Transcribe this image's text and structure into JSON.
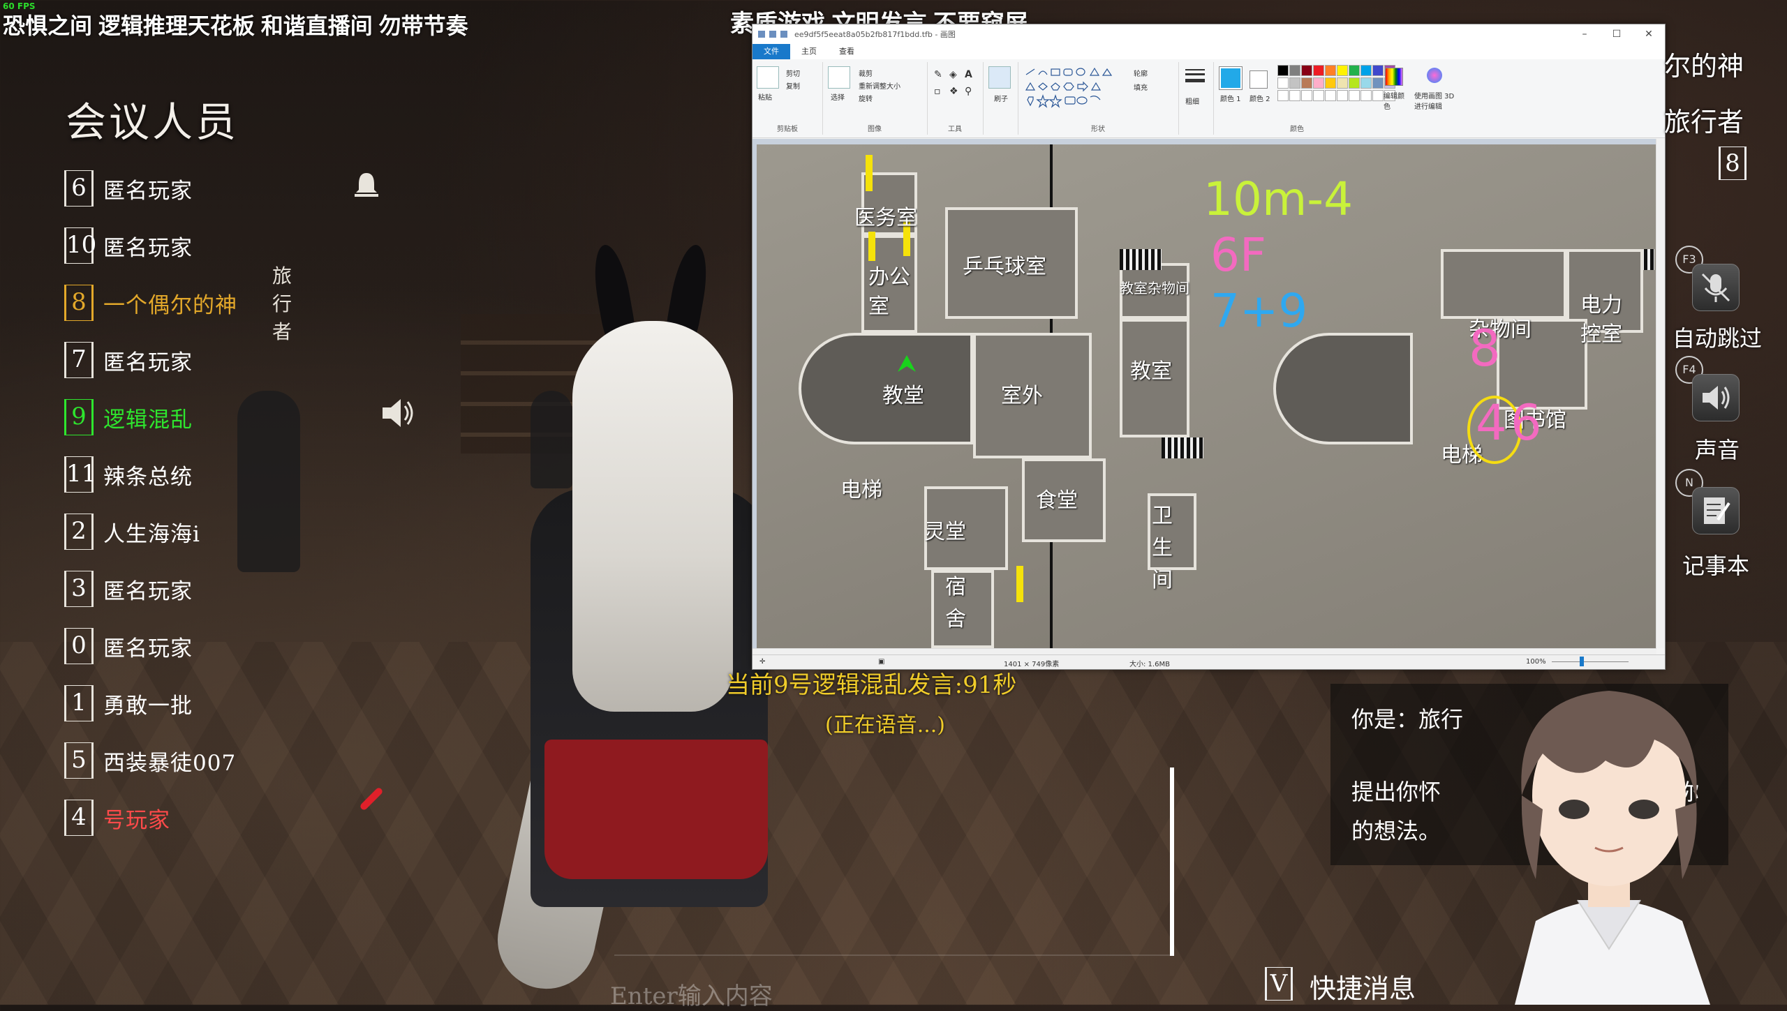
{
  "overlay": {
    "fps": "60 FPS",
    "banner_left": "恐惧之间 逻辑推理天花板 和谐直播间 勿带节奏",
    "banner_center": "素质游戏 文明发言 不要窥屏"
  },
  "players_panel": {
    "title": "会议人员",
    "players": [
      {
        "num": "6",
        "name": "匿名玩家",
        "tag": ""
      },
      {
        "num": "10",
        "name": "匿名玩家",
        "tag": ""
      },
      {
        "num": "8",
        "name": "一个偶尔的神",
        "tag": "旅行者"
      },
      {
        "num": "7",
        "name": "匿名玩家",
        "tag": ""
      },
      {
        "num": "9",
        "name": "逻辑混乱",
        "tag": ""
      },
      {
        "num": "11",
        "name": "辣条总统",
        "tag": ""
      },
      {
        "num": "2",
        "name": "人生海海i",
        "tag": ""
      },
      {
        "num": "3",
        "name": "匿名玩家",
        "tag": ""
      },
      {
        "num": "0",
        "name": "匿名玩家",
        "tag": ""
      },
      {
        "num": "1",
        "name": "勇敢一批",
        "tag": ""
      },
      {
        "num": "5",
        "name": "西装暴徒007",
        "tag": ""
      },
      {
        "num": "4",
        "name": "号玩家",
        "tag": ""
      }
    ]
  },
  "paint": {
    "title": "ee9df5f5eeat8a05b2fb817f1bdd.tfb - 画图",
    "tabs": {
      "file": "文件",
      "home": "主页",
      "view": "查看"
    },
    "ribbon": {
      "paste": "粘贴",
      "cut": "剪切",
      "copy": "复制",
      "clipboard": "剪贴板",
      "select": "选择",
      "crop": "裁剪",
      "resize": "重新调整大小",
      "rotate": "旋转",
      "image": "图像",
      "tools": "工具",
      "brushes": "刷子",
      "outline": "轮廓",
      "fill": "填充",
      "shapes": "形状",
      "size": "粗细",
      "color1": "颜色 1",
      "color2": "颜色 2",
      "colors": "颜色",
      "edit_colors": "编辑颜色",
      "paint3d": "使用画图 3D 进行编辑"
    },
    "status": {
      "dimensions": "1401 × 749像素",
      "filesize": "大小: 1.6MB",
      "zoom": "100%"
    },
    "palette": [
      "#000000",
      "#7f7f7f",
      "#880015",
      "#ed1c24",
      "#ff7f27",
      "#fff200",
      "#22b14c",
      "#00a2e8",
      "#3f48cc",
      "#a349a4",
      "#ffffff",
      "#c3c3c3",
      "#b97a57",
      "#ffaec9",
      "#ffc90e",
      "#efe4b0",
      "#b5e61d",
      "#99d9ea",
      "#7092be",
      "#c8bfe7"
    ],
    "map": {
      "rooms_left": {
        "infirmary": "医务室",
        "office": "办公室",
        "pingpong": "乒乓球室",
        "classroom_storage": "教室杂物间",
        "church": "教堂",
        "outdoor": "室外",
        "classroom": "教室",
        "elevator": "电梯",
        "mortuary": "灵堂",
        "canteen": "食堂",
        "toilet": "卫生间",
        "dorm": "宿舍"
      },
      "rooms_right": {
        "storage": "杂物间",
        "power": "电力控室",
        "library": "图书馆",
        "elevator": "电梯"
      },
      "annotations": {
        "line1": "10m-4",
        "line2": "6F",
        "line3": "7+9",
        "num8": "8",
        "num4": "4",
        "num6": "6"
      }
    }
  },
  "speech": {
    "current": "当前9号逻辑混乱发言:91秒",
    "voice": "(正在语音...)"
  },
  "chat": {
    "placeholder": "Enter输入内容"
  },
  "role_panel": {
    "line1": "你是：旅行",
    "line2_left": "提出你怀",
    "line2_right": "你",
    "line3": "的想法。"
  },
  "right_panel": {
    "partial1": "尔的神",
    "partial2": "旅行者",
    "player_num": "8",
    "auto_skip_key": "F3",
    "auto_skip": "自动跳过",
    "sound_key": "F4",
    "sound": "声音",
    "notes_key": "N",
    "notes": "记事本",
    "quick_key": "V",
    "quick_msg": "快捷消息"
  }
}
